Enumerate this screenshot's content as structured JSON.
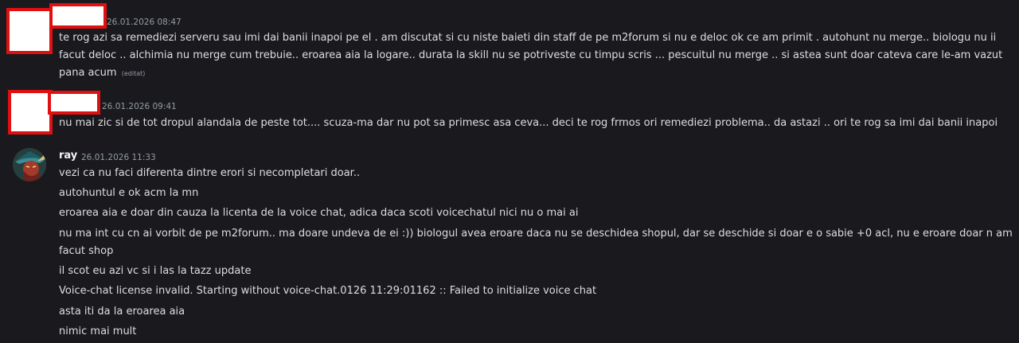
{
  "messages": [
    {
      "author": "",
      "timestamp": "26.01.2026 08:47",
      "lines": [
        "te rog azi sa remediezi serveru sau imi dai banii inapoi pe el . am discutat si cu niste baieti din staff de pe m2forum si nu e deloc ok ce am primit . autohunt nu merge.. biologu nu ii",
        "facut deloc .. alchimia nu merge cum trebuie.. eroarea aia la logare.. durata la skill  nu se potriveste cu timpu scris ... pescuitul nu merge .. si astea sunt doar cateva care le-am vazut",
        "pana acum"
      ],
      "edited_label": "(editat)"
    },
    {
      "author": "",
      "timestamp": "26.01.2026 09:41",
      "lines": [
        "nu mai zic si de tot dropul alandala de peste tot.... scuza-ma dar nu pot sa primesc asa ceva... deci te rog frmos ori remediezi problema.. da astazi .. ori te rog sa imi dai banii inapoi"
      ]
    },
    {
      "author": "ray",
      "timestamp": "26.01.2026 11:33",
      "lines": [
        "vezi ca nu faci diferenta dintre erori si necompletari doar..",
        "autohuntul e ok acm la mn",
        "eroarea aia e doar din cauza la licenta de la voice chat, adica daca scoti voicechatul nici nu o mai ai",
        "nu ma int cu cn ai vorbit de pe m2forum.. ma doare undeva de ei :)) biologul avea eroare daca nu se deschidea shopul, dar se deschide si doar e o sabie +0 acl, nu e eroare doar n am",
        "facut shop",
        "il scot eu azi vc si i las la tazz update",
        "Voice-chat license invalid. Starting without voice-chat.0126 11:29:01162 :: Failed to initialize voice chat",
        "asta iti da la eroarea aia",
        "nimic mai mult"
      ]
    }
  ]
}
